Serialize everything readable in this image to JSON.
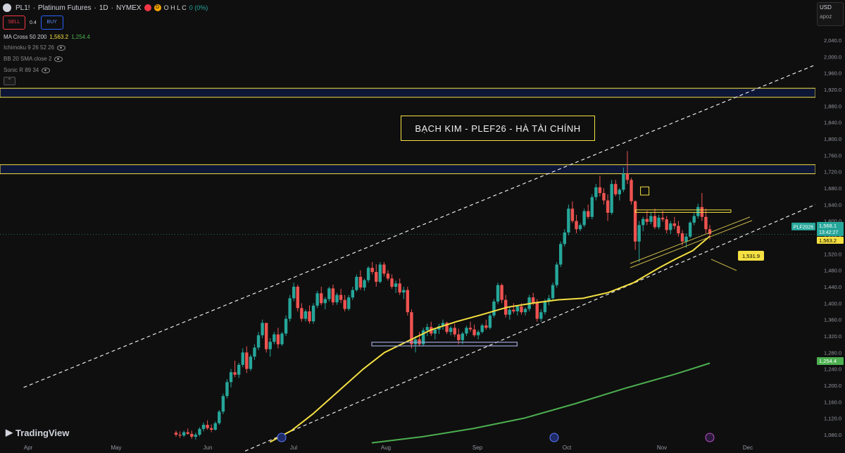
{
  "header": {
    "symbol": "PL1!",
    "name": "Platinum Futures",
    "interval": "1D",
    "exchange": "NYMEX",
    "ohlc": "O H L C",
    "change": "0 (0%)",
    "d_badge": "D"
  },
  "trade": {
    "sell_label": "SELL",
    "buy_label": "BUY",
    "spread": "0.4"
  },
  "indicators": [
    {
      "label": "MA Cross 50 200",
      "v1": "1,563.2",
      "v2": "1,254.4"
    },
    {
      "label": "Ichimoku 9 26 52 26"
    },
    {
      "label": "BB 20 SMA close 2"
    },
    {
      "label": "Sonic R 89 34"
    }
  ],
  "currency": {
    "unit": "USD",
    "mode": "apoz"
  },
  "title_box": "BẠCH KIM - PLEF26 - HÀ TÀI CHÍNH",
  "brand": "TradingView",
  "colors": {
    "bull": "#26a69a",
    "bear": "#ef5350",
    "ma50": "#f5e042",
    "ma200": "#4caf50",
    "zone_border": "#f5e042",
    "zone_fill": "#0d1637"
  },
  "chart_data": {
    "type": "candlestick",
    "ylim": [
      1060,
      2060
    ],
    "y_ticks": [
      1080,
      1120,
      1160,
      1200,
      1240,
      1280,
      1320,
      1360,
      1400,
      1440,
      1480,
      1520,
      1560,
      1600,
      1640,
      1680,
      1720,
      1760,
      1800,
      1840,
      1880,
      1920,
      1960,
      2000,
      2040
    ],
    "y_tick_labels": [
      "1,080.0",
      "1,120.0",
      "1,160.0",
      "1,200.0",
      "1,240.0",
      "1,280.0",
      "1,320.0",
      "1,360.0",
      "1,400.0",
      "1,440.0",
      "1,480.0",
      "1,520.0",
      "1,560.0",
      "1,600.0",
      "1,640.0",
      "1,680.0",
      "1,720.0",
      "1,760.0",
      "1,800.0",
      "1,840.0",
      "1,880.0",
      "1,920.0",
      "1,960.0",
      "2,000.0",
      "2,040.0"
    ],
    "x_labels": [
      "Apr",
      "May",
      "Jun",
      "Jul",
      "Aug",
      "Sep",
      "Oct",
      "Nov",
      "Dec"
    ],
    "candles": [
      [
        1085,
        1090,
        1075,
        1080
      ],
      [
        1080,
        1088,
        1072,
        1078
      ],
      [
        1078,
        1090,
        1074,
        1086
      ],
      [
        1086,
        1095,
        1080,
        1082
      ],
      [
        1082,
        1090,
        1070,
        1075
      ],
      [
        1075,
        1085,
        1068,
        1080
      ],
      [
        1080,
        1098,
        1076,
        1094
      ],
      [
        1094,
        1110,
        1088,
        1104
      ],
      [
        1104,
        1115,
        1092,
        1096
      ],
      [
        1096,
        1105,
        1086,
        1092
      ],
      [
        1092,
        1112,
        1090,
        1108
      ],
      [
        1108,
        1140,
        1104,
        1136
      ],
      [
        1136,
        1180,
        1130,
        1174
      ],
      [
        1174,
        1215,
        1168,
        1208
      ],
      [
        1208,
        1240,
        1195,
        1232
      ],
      [
        1232,
        1260,
        1220,
        1226
      ],
      [
        1226,
        1255,
        1218,
        1250
      ],
      [
        1250,
        1290,
        1244,
        1280
      ],
      [
        1280,
        1295,
        1230,
        1240
      ],
      [
        1240,
        1275,
        1235,
        1270
      ],
      [
        1270,
        1300,
        1262,
        1292
      ],
      [
        1292,
        1330,
        1286,
        1322
      ],
      [
        1322,
        1360,
        1315,
        1352
      ],
      [
        1352,
        1350,
        1280,
        1288
      ],
      [
        1288,
        1315,
        1270,
        1306
      ],
      [
        1306,
        1330,
        1300,
        1324
      ],
      [
        1324,
        1340,
        1290,
        1300
      ],
      [
        1300,
        1330,
        1296,
        1326
      ],
      [
        1326,
        1370,
        1320,
        1362
      ],
      [
        1362,
        1420,
        1355,
        1412
      ],
      [
        1412,
        1450,
        1405,
        1440
      ],
      [
        1440,
        1445,
        1380,
        1388
      ],
      [
        1388,
        1400,
        1355,
        1362
      ],
      [
        1362,
        1385,
        1355,
        1380
      ],
      [
        1380,
        1395,
        1350,
        1356
      ],
      [
        1356,
        1400,
        1350,
        1394
      ],
      [
        1394,
        1430,
        1388,
        1424
      ],
      [
        1424,
        1440,
        1395,
        1400
      ],
      [
        1400,
        1415,
        1385,
        1410
      ],
      [
        1410,
        1440,
        1404,
        1436
      ],
      [
        1436,
        1445,
        1395,
        1402
      ],
      [
        1402,
        1425,
        1396,
        1420
      ],
      [
        1420,
        1435,
        1400,
        1408
      ],
      [
        1408,
        1420,
        1380,
        1386
      ],
      [
        1386,
        1420,
        1382,
        1414
      ],
      [
        1414,
        1440,
        1408,
        1432
      ],
      [
        1432,
        1470,
        1428,
        1464
      ],
      [
        1464,
        1480,
        1432,
        1438
      ],
      [
        1438,
        1460,
        1430,
        1456
      ],
      [
        1456,
        1490,
        1450,
        1486
      ],
      [
        1486,
        1500,
        1470,
        1476
      ],
      [
        1476,
        1495,
        1440,
        1452
      ],
      [
        1452,
        1500,
        1448,
        1494
      ],
      [
        1494,
        1500,
        1465,
        1472
      ],
      [
        1472,
        1480,
        1455,
        1460
      ],
      [
        1460,
        1470,
        1435,
        1440
      ],
      [
        1440,
        1455,
        1425,
        1448
      ],
      [
        1448,
        1460,
        1420,
        1426
      ],
      [
        1426,
        1440,
        1410,
        1432
      ],
      [
        1432,
        1440,
        1370,
        1378
      ],
      [
        1378,
        1385,
        1290,
        1300
      ],
      [
        1300,
        1320,
        1280,
        1312
      ],
      [
        1312,
        1330,
        1295,
        1300
      ],
      [
        1300,
        1340,
        1295,
        1334
      ],
      [
        1334,
        1350,
        1320,
        1342
      ],
      [
        1342,
        1355,
        1320,
        1326
      ],
      [
        1326,
        1340,
        1312,
        1336
      ],
      [
        1336,
        1350,
        1325,
        1344
      ],
      [
        1344,
        1360,
        1335,
        1352
      ],
      [
        1352,
        1355,
        1325,
        1330
      ],
      [
        1330,
        1345,
        1322,
        1340
      ],
      [
        1340,
        1350,
        1318,
        1324
      ],
      [
        1324,
        1338,
        1300,
        1310
      ],
      [
        1310,
        1330,
        1300,
        1326
      ],
      [
        1326,
        1345,
        1320,
        1340
      ],
      [
        1340,
        1355,
        1330,
        1336
      ],
      [
        1336,
        1348,
        1318,
        1322
      ],
      [
        1322,
        1335,
        1312,
        1330
      ],
      [
        1330,
        1350,
        1326,
        1346
      ],
      [
        1346,
        1360,
        1335,
        1340
      ],
      [
        1340,
        1375,
        1336,
        1370
      ],
      [
        1370,
        1410,
        1365,
        1404
      ],
      [
        1404,
        1450,
        1398,
        1444
      ],
      [
        1444,
        1448,
        1400,
        1408
      ],
      [
        1408,
        1420,
        1365,
        1372
      ],
      [
        1372,
        1390,
        1360,
        1384
      ],
      [
        1384,
        1400,
        1375,
        1380
      ],
      [
        1380,
        1395,
        1370,
        1392
      ],
      [
        1392,
        1400,
        1372,
        1378
      ],
      [
        1378,
        1390,
        1370,
        1386
      ],
      [
        1386,
        1420,
        1380,
        1414
      ],
      [
        1414,
        1425,
        1395,
        1400
      ],
      [
        1400,
        1410,
        1355,
        1362
      ],
      [
        1362,
        1385,
        1355,
        1378
      ],
      [
        1378,
        1410,
        1372,
        1404
      ],
      [
        1404,
        1420,
        1395,
        1412
      ],
      [
        1412,
        1450,
        1405,
        1444
      ],
      [
        1444,
        1500,
        1438,
        1494
      ],
      [
        1494,
        1550,
        1488,
        1544
      ],
      [
        1544,
        1580,
        1538,
        1572
      ],
      [
        1572,
        1640,
        1565,
        1630
      ],
      [
        1630,
        1648,
        1595,
        1600
      ],
      [
        1600,
        1615,
        1570,
        1580
      ],
      [
        1580,
        1595,
        1575,
        1590
      ],
      [
        1590,
        1630,
        1585,
        1624
      ],
      [
        1624,
        1640,
        1605,
        1610
      ],
      [
        1610,
        1665,
        1604,
        1658
      ],
      [
        1658,
        1690,
        1650,
        1682
      ],
      [
        1682,
        1710,
        1660,
        1668
      ],
      [
        1668,
        1680,
        1640,
        1650
      ],
      [
        1650,
        1665,
        1600,
        1620
      ],
      [
        1620,
        1700,
        1615,
        1690
      ],
      [
        1690,
        1700,
        1660,
        1665
      ],
      [
        1665,
        1680,
        1650,
        1676
      ],
      [
        1676,
        1730,
        1670,
        1715
      ],
      [
        1715,
        1770,
        1690,
        1700
      ],
      [
        1700,
        1705,
        1640,
        1648
      ],
      [
        1648,
        1650,
        1530,
        1550
      ],
      [
        1550,
        1600,
        1500,
        1590
      ],
      [
        1590,
        1610,
        1575,
        1605
      ],
      [
        1605,
        1625,
        1590,
        1598
      ],
      [
        1598,
        1620,
        1592,
        1612
      ],
      [
        1612,
        1630,
        1580,
        1585
      ],
      [
        1585,
        1615,
        1580,
        1608
      ],
      [
        1608,
        1625,
        1598,
        1604
      ],
      [
        1604,
        1612,
        1570,
        1578
      ],
      [
        1578,
        1600,
        1568,
        1594
      ],
      [
        1594,
        1610,
        1580,
        1588
      ],
      [
        1588,
        1600,
        1562,
        1570
      ],
      [
        1570,
        1578,
        1540,
        1550
      ],
      [
        1550,
        1570,
        1535,
        1562
      ],
      [
        1562,
        1600,
        1558,
        1596
      ],
      [
        1596,
        1620,
        1590,
        1612
      ],
      [
        1612,
        1642,
        1606,
        1634
      ],
      [
        1634,
        1668,
        1600,
        1610
      ],
      [
        1610,
        1630,
        1570,
        1580
      ],
      [
        1580,
        1590,
        1555,
        1568
      ]
    ],
    "ma50": [
      {
        "x": 0.3195,
        "y": 1062
      },
      {
        "x": 0.345,
        "y": 1090
      },
      {
        "x": 0.37,
        "y": 1130
      },
      {
        "x": 0.4,
        "y": 1185
      },
      {
        "x": 0.43,
        "y": 1240
      },
      {
        "x": 0.455,
        "y": 1280
      },
      {
        "x": 0.48,
        "y": 1305
      },
      {
        "x": 0.51,
        "y": 1335
      },
      {
        "x": 0.54,
        "y": 1355
      },
      {
        "x": 0.57,
        "y": 1372
      },
      {
        "x": 0.6,
        "y": 1390
      },
      {
        "x": 0.63,
        "y": 1400
      },
      {
        "x": 0.66,
        "y": 1408
      },
      {
        "x": 0.69,
        "y": 1412
      },
      {
        "x": 0.72,
        "y": 1426
      },
      {
        "x": 0.75,
        "y": 1450
      },
      {
        "x": 0.78,
        "y": 1486
      },
      {
        "x": 0.8,
        "y": 1508
      },
      {
        "x": 0.82,
        "y": 1528
      },
      {
        "x": 0.84,
        "y": 1563
      }
    ],
    "ma200": [
      {
        "x": 0.44,
        "y": 1060
      },
      {
        "x": 0.5,
        "y": 1075
      },
      {
        "x": 0.56,
        "y": 1095
      },
      {
        "x": 0.62,
        "y": 1120
      },
      {
        "x": 0.68,
        "y": 1155
      },
      {
        "x": 0.74,
        "y": 1193
      },
      {
        "x": 0.8,
        "y": 1228
      },
      {
        "x": 0.84,
        "y": 1254
      }
    ],
    "channel_upper": [
      [
        0.028,
        1195
      ],
      [
        0.965,
        1980
      ]
    ],
    "channel_mid": [
      [
        0.29,
        1040
      ],
      [
        0.965,
        1640
      ]
    ],
    "zones": [
      {
        "y1": 1923,
        "y2": 1901
      },
      {
        "y1": 1737,
        "y2": 1715
      }
    ],
    "box_support": {
      "x1": 0.44,
      "x2": 0.612,
      "y1": 1305,
      "y2": 1296
    },
    "box_resistance": {
      "x1": 0.752,
      "x2": 0.865,
      "y1": 1627,
      "y2": 1621
    },
    "small_box": {
      "x1": 0.758,
      "x2": 0.768,
      "y1": 1683,
      "y2": 1663
    },
    "price_labels": [
      {
        "text": "1,568.1",
        "sub": "13:42:27",
        "y": 1568,
        "color": "#26a69a",
        "tag": "PLF2026"
      },
      {
        "text": "1,563.2",
        "y": 1556,
        "color": "#f5e042"
      },
      {
        "text": "1,254.4",
        "y": 1254,
        "color": "#4caf50"
      }
    ],
    "callout": {
      "text": "1,531.9",
      "y": 1531.9
    }
  }
}
